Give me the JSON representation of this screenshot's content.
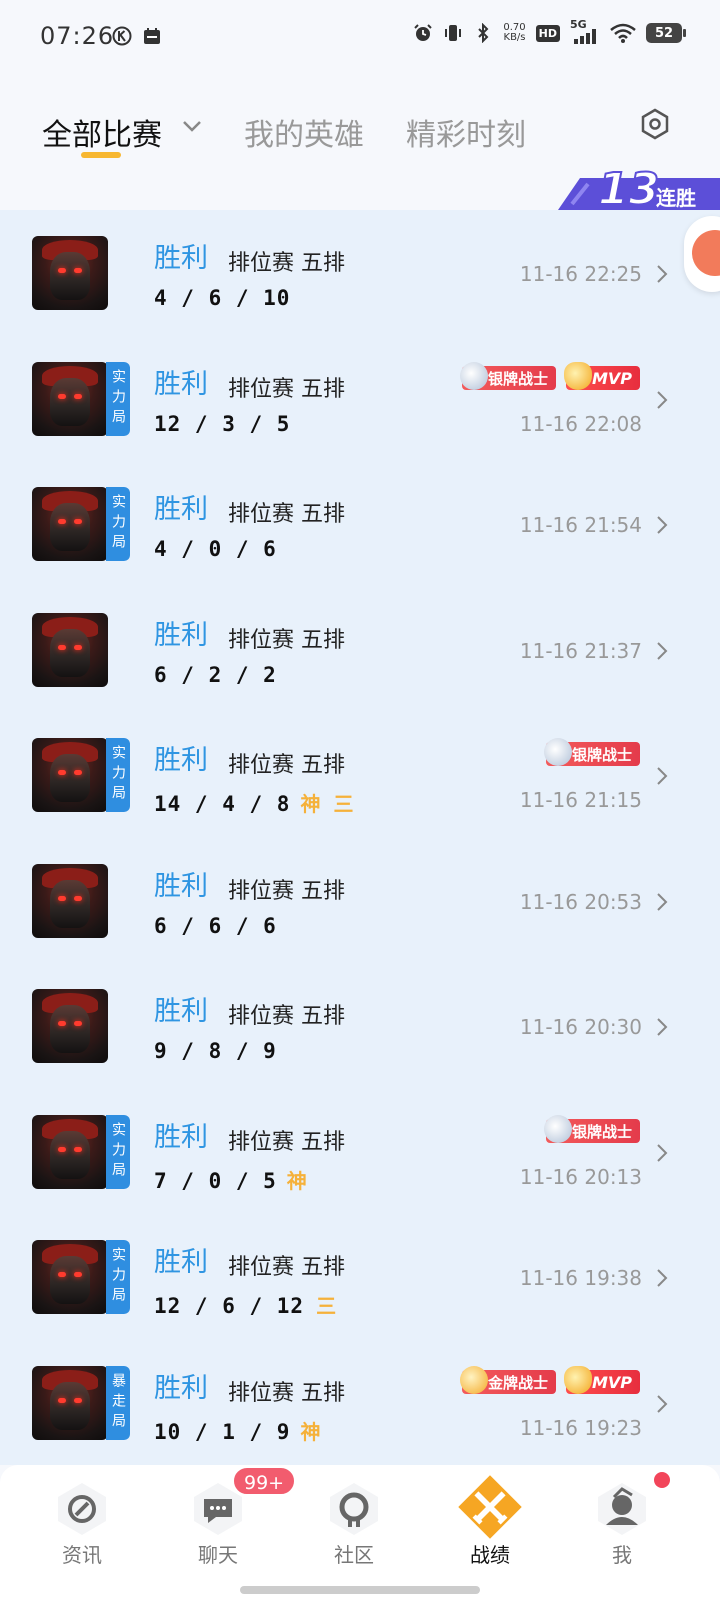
{
  "status_bar": {
    "time": "07:26",
    "net_speed_value": "0.70",
    "net_speed_unit": "KB/s",
    "hd_label": "HD",
    "network_label": "5G",
    "battery": "52"
  },
  "tabs": [
    {
      "label": "全部比赛",
      "active": true
    },
    {
      "label": "我的英雄",
      "active": false
    },
    {
      "label": "精彩时刻",
      "active": false
    }
  ],
  "streak": {
    "number": "13",
    "label": "连胜"
  },
  "matches": [
    {
      "result": "胜利",
      "mode": "排位赛 五排",
      "kda": "4 / 6 / 10",
      "rank_badge": "",
      "tags": [],
      "badges": [],
      "time": "11-16 22:25"
    },
    {
      "result": "胜利",
      "mode": "排位赛 五排",
      "kda": "12 / 3 / 5",
      "rank_badge": "实力局",
      "tags": [],
      "badges": [
        "银牌战士",
        "MVP"
      ],
      "time": "11-16 22:08"
    },
    {
      "result": "胜利",
      "mode": "排位赛 五排",
      "kda": "4 / 0 / 6",
      "rank_badge": "实力局",
      "tags": [],
      "badges": [],
      "time": "11-16 21:54"
    },
    {
      "result": "胜利",
      "mode": "排位赛 五排",
      "kda": "6 / 2 / 2",
      "rank_badge": "",
      "tags": [],
      "badges": [],
      "time": "11-16 21:37"
    },
    {
      "result": "胜利",
      "mode": "排位赛 五排",
      "kda": "14 / 4 / 8",
      "rank_badge": "实力局",
      "tags": [
        "神",
        "三"
      ],
      "badges": [
        "银牌战士"
      ],
      "time": "11-16 21:15"
    },
    {
      "result": "胜利",
      "mode": "排位赛 五排",
      "kda": "6 / 6 / 6",
      "rank_badge": "",
      "tags": [],
      "badges": [],
      "time": "11-16 20:53"
    },
    {
      "result": "胜利",
      "mode": "排位赛 五排",
      "kda": "9 / 8 / 9",
      "rank_badge": "",
      "tags": [],
      "badges": [],
      "time": "11-16 20:30"
    },
    {
      "result": "胜利",
      "mode": "排位赛 五排",
      "kda": "7 / 0 / 5",
      "rank_badge": "实力局",
      "tags": [
        "神"
      ],
      "badges": [
        "银牌战士"
      ],
      "time": "11-16 20:13"
    },
    {
      "result": "胜利",
      "mode": "排位赛 五排",
      "kda": "12 / 6 / 12",
      "rank_badge": "实力局",
      "tags": [
        "三"
      ],
      "badges": [],
      "time": "11-16 19:38"
    },
    {
      "result": "胜利",
      "mode": "排位赛 五排",
      "kda": "10 / 1 / 9",
      "rank_badge": "暴走局",
      "tags": [
        "神"
      ],
      "badges": [
        "金牌战士",
        "MVP"
      ],
      "time": "11-16 19:23"
    }
  ],
  "bottom_nav": [
    {
      "label": "资讯",
      "active": false
    },
    {
      "label": "聊天",
      "active": false,
      "badge": "99+"
    },
    {
      "label": "社区",
      "active": false
    },
    {
      "label": "战绩",
      "active": true
    },
    {
      "label": "我",
      "active": false,
      "dot": true
    }
  ],
  "colors": {
    "accent": "#f7b731",
    "win_blue": "#2f95e2",
    "list_bg": "#e8f1fb",
    "rank_badge_blue": "#2f8ee0",
    "medal_red": "#e43b4b",
    "active_nav_orange": "#f6a623"
  }
}
